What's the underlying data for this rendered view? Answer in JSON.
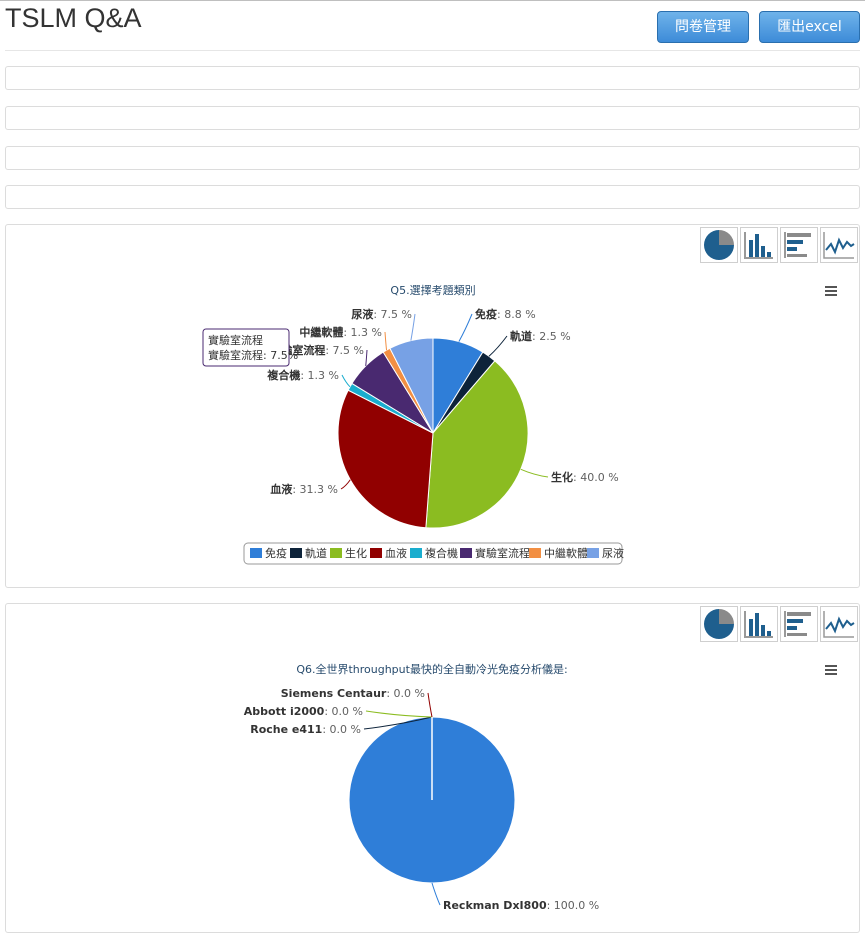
{
  "header": {
    "title": "TSLM Q&A"
  },
  "toolbar": {
    "manage_label": "問卷管理",
    "export_label": "匯出excel"
  },
  "chart_switcher": {
    "icons": [
      "pie-chart-icon",
      "bar-chart-icon",
      "horizontal-bar-chart-icon",
      "line-chart-icon"
    ]
  },
  "colors": {
    "accent": "#3d8bd8",
    "series": [
      "#2f7ed8",
      "#0d233a",
      "#8bbc21",
      "#910000",
      "#1aadce",
      "#492970",
      "#f28f43",
      "#77a1e5"
    ]
  },
  "tooltip": {
    "lines": [
      "實驗室流程",
      "實驗室流程: 7.5%"
    ]
  },
  "chart_data": [
    {
      "type": "pie",
      "title": "Q5.選擇考題類別",
      "categories": [
        "免疫",
        "軌道",
        "生化",
        "血液",
        "複合機",
        "實驗室流程",
        "中繼軟體",
        "尿液"
      ],
      "values": [
        8.8,
        2.5,
        40.0,
        31.3,
        1.3,
        7.5,
        1.3,
        7.5
      ],
      "unit": "%",
      "legend": {
        "placement": "bottom",
        "labels": [
          "免疫",
          "軌道",
          "生化",
          "血液",
          "複合機",
          "實驗室流程",
          "中繼軟體",
          "尿液"
        ]
      }
    },
    {
      "type": "pie",
      "title": "Q6.全世界throughput最快的全自動冷光免疫分析儀是:",
      "categories": [
        "Reckman DxI800",
        "Roche e411",
        "Abbott i2000",
        "Siemens Centaur"
      ],
      "values": [
        100.0,
        0.0,
        0.0,
        0.0
      ],
      "unit": "%"
    }
  ]
}
